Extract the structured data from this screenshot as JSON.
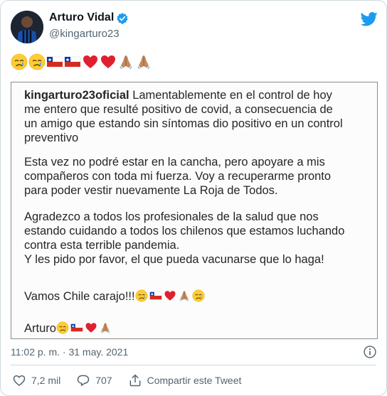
{
  "author": {
    "name": "Arturo Vidal",
    "handle": "@kingarturo23",
    "verified": true
  },
  "header_emojis": [
    "crying-face-icon",
    "crying-face-icon",
    "chile-flag-icon",
    "chile-flag-icon",
    "red-heart-icon",
    "red-heart-icon",
    "folded-hands-icon",
    "folded-hands-icon"
  ],
  "post": {
    "username": "kingarturo23oficial",
    "p1_line1": " Lamentablemente en el control de hoy",
    "p1_line2": "me entero que resulté positivo de covid, a consecuencia de",
    "p1_line3": "un amigo que estando sin síntomas dio positivo en un control",
    "p1_line4": "preventivo",
    "p2_line1": "Esta vez no podré estar en la cancha, pero apoyare a mis",
    "p2_line2": "compañeros con toda mi fuerza. Voy a recuperarme pronto",
    "p2_line3": "para poder vestir nuevamente La Roja de Todos.",
    "p3_line1": "Agradezco a todos los profesionales de la salud que nos",
    "p3_line2": "estando cuidando a todos los chilenos que estamos luchando",
    "p3_line3": "contra esta terrible pandemia.",
    "p3_line4": "Y les pido por favor, el que pueda vacunarse que lo haga!",
    "p4": "Vamos Chile carajo!!!",
    "p5": "Arturo"
  },
  "timestamp": "11:02 p. m. · 31 may. 2021",
  "actions": {
    "likes": "7,2 mil",
    "replies": "707",
    "share": "Compartir este Tweet"
  },
  "colors": {
    "twitter_blue": "#1d9bf0",
    "secondary_text": "#536471",
    "heart_red": "#e0202f"
  }
}
